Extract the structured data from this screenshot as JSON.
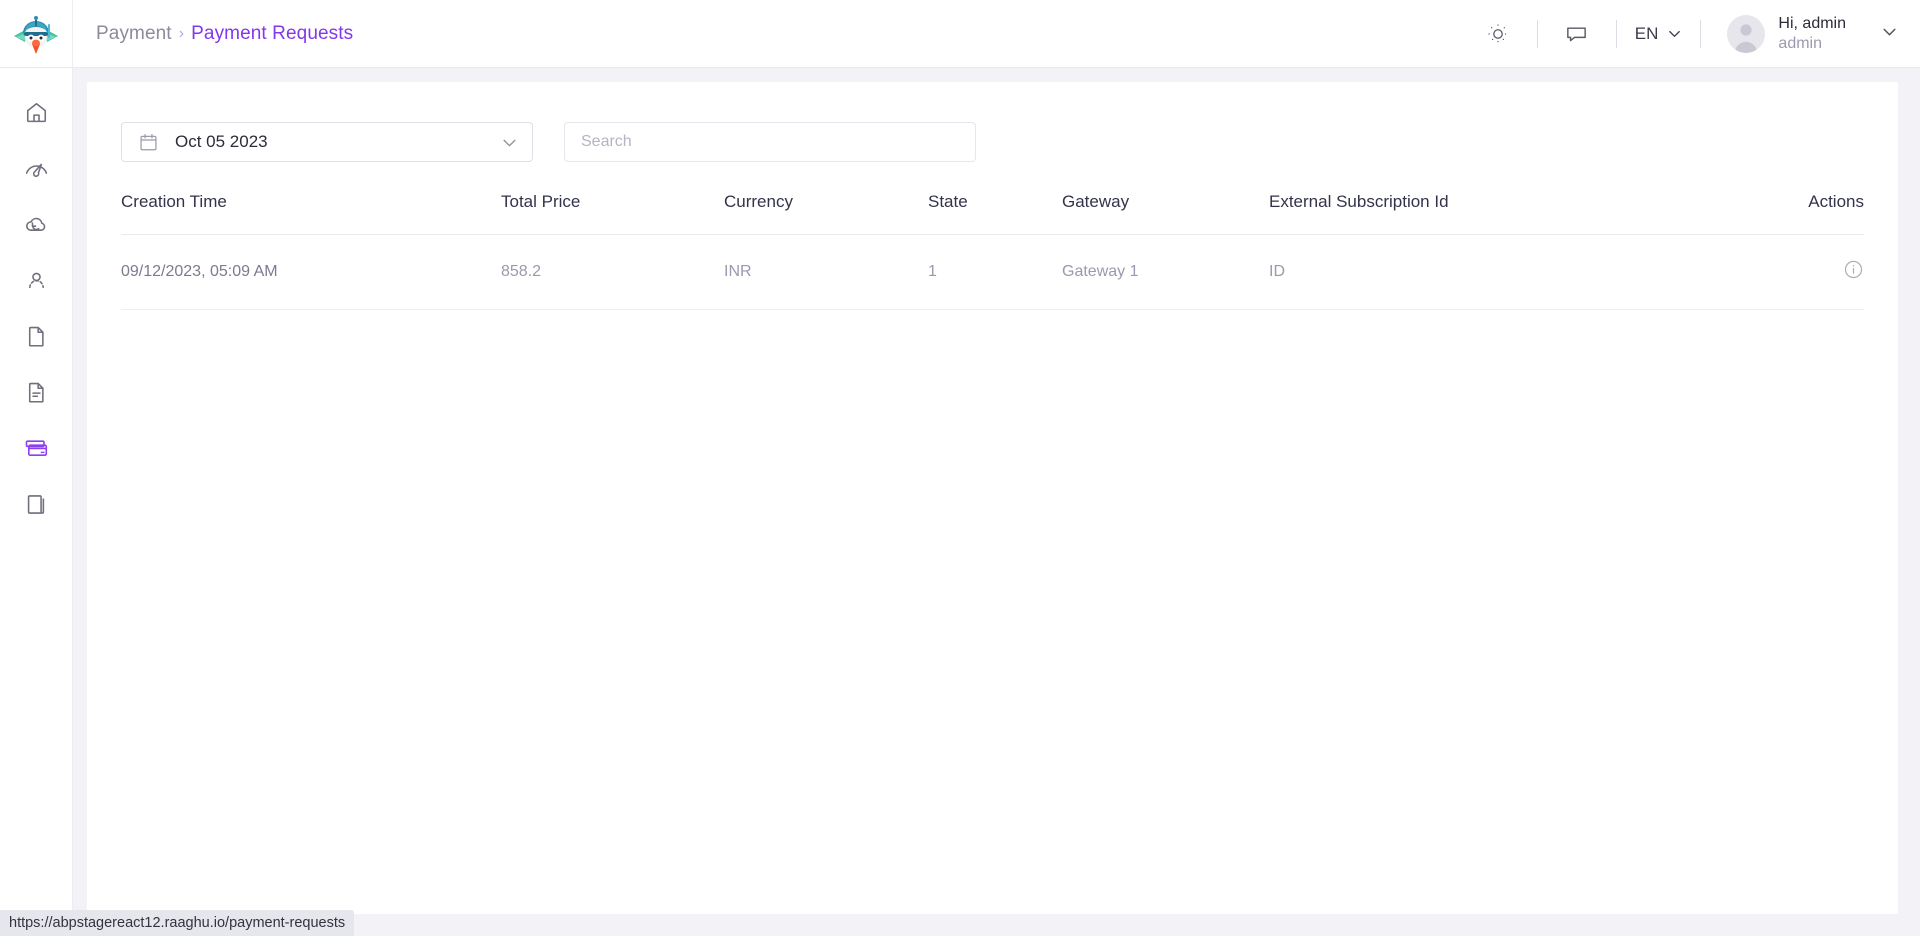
{
  "header": {
    "logo_icon": "bird-plane-logo",
    "breadcrumb": {
      "root": "Payment",
      "separator": "›",
      "current": "Payment Requests"
    },
    "theme_icon": "sun-icon",
    "chat_icon": "chat-bubble-icon",
    "language": "EN",
    "language_caret_icon": "chevron-down-icon",
    "avatar_icon": "user-avatar-icon",
    "greeting": "Hi, admin",
    "username": "admin",
    "user_caret_icon": "chevron-down-icon"
  },
  "sidebar": {
    "items": [
      {
        "name": "home",
        "icon": "home-icon",
        "active": false
      },
      {
        "name": "dashboard",
        "icon": "speedometer-icon",
        "active": false
      },
      {
        "name": "saas",
        "icon": "cloud-refresh-icon",
        "active": false
      },
      {
        "name": "administration",
        "icon": "user-group-icon",
        "active": false
      },
      {
        "name": "file",
        "icon": "file-icon",
        "active": false
      },
      {
        "name": "reports",
        "icon": "document-lines-icon",
        "active": false
      },
      {
        "name": "payment",
        "icon": "credit-card-icon",
        "active": true
      },
      {
        "name": "catalog",
        "icon": "book-icon",
        "active": false
      }
    ],
    "active_color": "#8b3ff0"
  },
  "filters": {
    "date_icon": "calendar-icon",
    "date_value": "Oct 05 2023",
    "date_caret_icon": "chevron-down-icon",
    "search_placeholder": "Search",
    "search_value": ""
  },
  "table": {
    "columns": [
      "Creation Time",
      "Total Price",
      "Currency",
      "State",
      "Gateway",
      "External Subscription Id",
      "Actions"
    ],
    "rows": [
      {
        "creation_time": "09/12/2023, 05:09 AM",
        "total_price": "858.2",
        "currency": "INR",
        "state": "1",
        "gateway": "Gateway 1",
        "external_subscription_id": "ID",
        "action_icon": "info-circle-icon"
      }
    ]
  },
  "statusbar": {
    "url": "https://abpstagereact12.raaghu.io/payment-requests"
  },
  "colors": {
    "accent": "#8338ec",
    "page_bg": "#f2f2f7",
    "card_bg": "#ffffff",
    "muted_text": "#9a9aae"
  }
}
